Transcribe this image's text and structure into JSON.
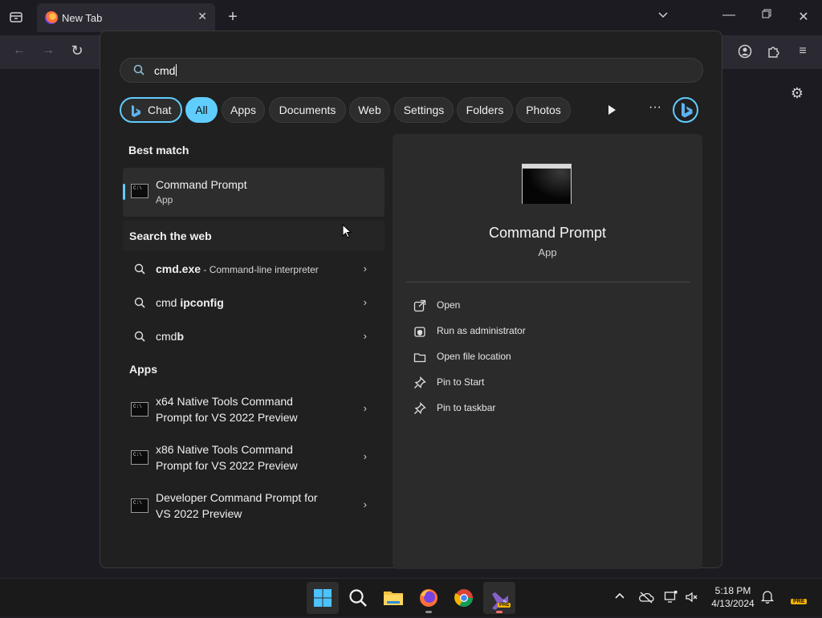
{
  "browser": {
    "tab_title": "New Tab",
    "icons": [
      "tab-list-icon",
      "firefox-icon",
      "close-icon",
      "plus-icon",
      "chevron-down-icon",
      "minimize-icon",
      "restore-icon",
      "close-window-icon",
      "back-icon",
      "forward-icon",
      "reload-icon",
      "account-icon",
      "extensions-icon",
      "menu-icon",
      "gear-icon"
    ]
  },
  "search": {
    "query": "cmd",
    "filters": [
      "Chat",
      "All",
      "Apps",
      "Documents",
      "Web",
      "Settings",
      "Folders",
      "Photos"
    ],
    "active_filter": "All"
  },
  "results": {
    "best_match_title": "Best match",
    "best_match": {
      "name": "Command Prompt",
      "type": "App"
    },
    "web_title": "Search the web",
    "web": [
      {
        "term": "cmd.exe",
        "suffix": " - Command-line interpreter"
      },
      {
        "term": "cmd ",
        "bold": "ipconfig"
      },
      {
        "term": "cmd",
        "bold": "b"
      }
    ],
    "apps_title": "Apps",
    "apps": [
      {
        "line1": "x64 Native Tools Command",
        "line2": "Prompt for VS 2022 Preview"
      },
      {
        "line1": "x86 Native Tools Command",
        "line2": "Prompt for VS 2022 Preview"
      },
      {
        "line1": "Developer Command Prompt for",
        "line2": "VS 2022 Preview"
      }
    ]
  },
  "detail": {
    "name": "Command Prompt",
    "type": "App",
    "actions": [
      "Open",
      "Run as administrator",
      "Open file location",
      "Pin to Start",
      "Pin to taskbar"
    ]
  },
  "taskbar": {
    "time": "5:18 PM",
    "date": "4/13/2024",
    "pre_badge": "PRE",
    "accent": "#60cdff"
  }
}
